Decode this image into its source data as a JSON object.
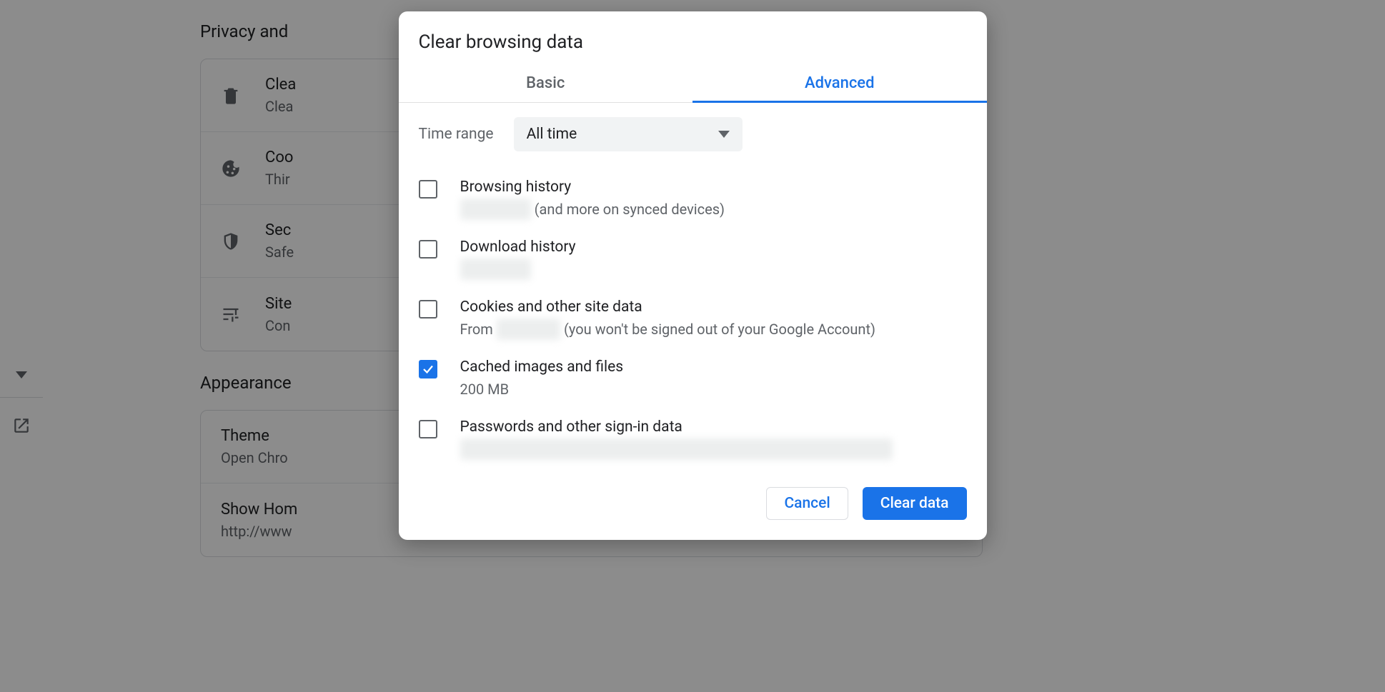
{
  "dialog": {
    "title": "Clear browsing data",
    "tabs": {
      "basic": "Basic",
      "advanced": "Advanced",
      "active": "advanced"
    },
    "timeRange": {
      "label": "Time range",
      "value": "All time"
    },
    "options": {
      "browsingHistory": {
        "title": "Browsing history",
        "sub_suffix": " (and more on synced devices)",
        "blur": "xx xxx xxxx",
        "checked": false
      },
      "downloadHistory": {
        "title": "Download history",
        "blur": "xx xxx xxxx",
        "checked": false
      },
      "cookies": {
        "title": "Cookies and other site data",
        "sub_prefix": "From ",
        "blur": "xx xx xxxx",
        "sub_suffix": " (you won't be signed out of your Google Account)",
        "checked": false
      },
      "cache": {
        "title": "Cached images and files",
        "sub": "200 MB",
        "checked": true
      },
      "passwords": {
        "title": "Passwords and other sign-in data",
        "blur": "xxx xxxxxxxxx xxx xxxxxxxxxxxxx xxx xxxxx xxx xxx xxx xxxx xxxxxxx",
        "checked": false
      }
    },
    "actions": {
      "cancel": "Cancel",
      "clear": "Clear data"
    }
  },
  "settings": {
    "sections": {
      "privacy": {
        "title": "Privacy and",
        "items": {
          "clear": {
            "title": "Clea",
            "sub": "Clea"
          },
          "cookies": {
            "title": "Coo",
            "sub": "Thir"
          },
          "security": {
            "title": "Sec",
            "sub": "Safe"
          },
          "site": {
            "title": "Site",
            "sub": "Con"
          }
        }
      },
      "appearance": {
        "title": "Appearance",
        "items": {
          "theme": {
            "title": "Theme",
            "sub": "Open Chro"
          },
          "home": {
            "title": "Show Hom",
            "sub": "http://www"
          }
        }
      }
    }
  }
}
